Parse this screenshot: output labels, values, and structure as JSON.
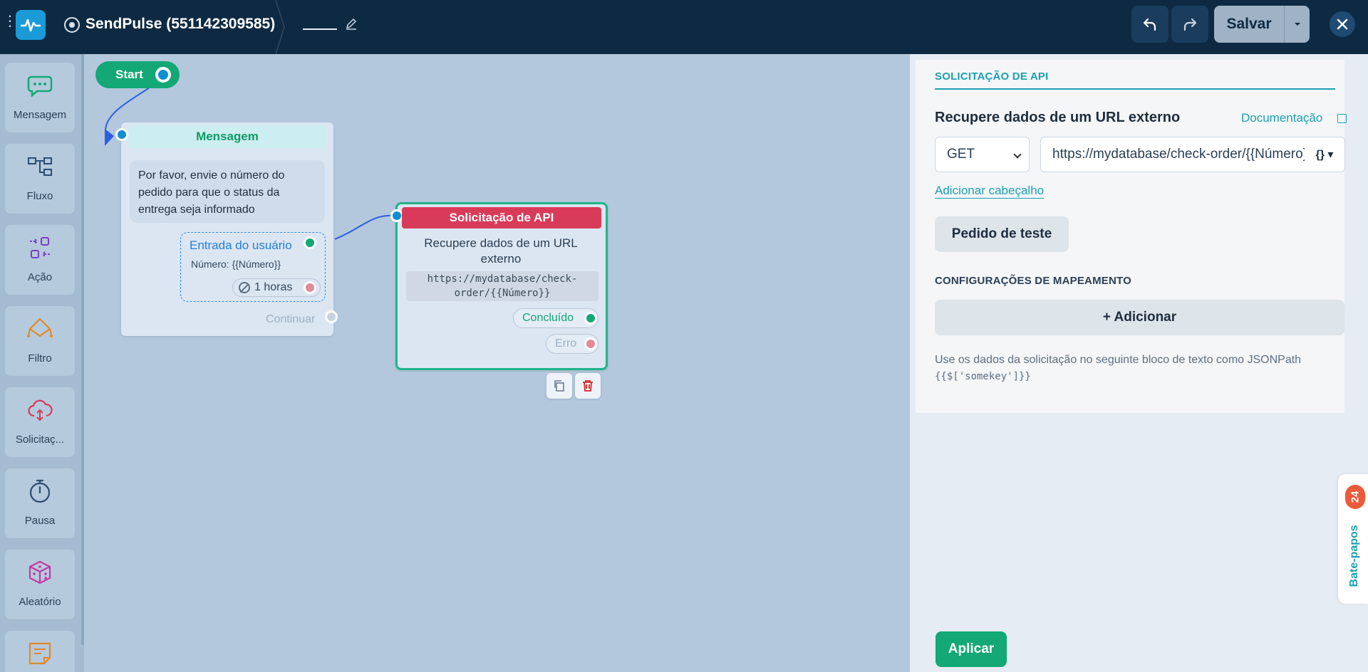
{
  "header": {
    "bot_name": "SendPulse (551142309585)",
    "save_label": "Salvar"
  },
  "sidebar": {
    "items": [
      {
        "label": "Mensagem",
        "icon": "chat-bubble-icon"
      },
      {
        "label": "Fluxo",
        "icon": "flow-icon"
      },
      {
        "label": "Ação",
        "icon": "action-icon"
      },
      {
        "label": "Filtro",
        "icon": "filter-icon"
      },
      {
        "label": "Solicitaç...",
        "icon": "cloud-request-icon"
      },
      {
        "label": "Pausa",
        "icon": "stopwatch-icon"
      },
      {
        "label": "Aleatório",
        "icon": "dice-icon"
      }
    ]
  },
  "canvas": {
    "start_label": "Start",
    "message_node": {
      "title": "Mensagem",
      "text": "Por favor, envie o número do pedido para que o status da entrega seja informado",
      "input_title": "Entrada do usuário",
      "input_var": "Número: {{Número}}",
      "timeout": "1 horas",
      "continue": "Continuar"
    },
    "api_node": {
      "title": "Solicitação de API",
      "description": "Recupere dados de um URL externo",
      "url": "https://mydatabase/check-order/{{Número}}",
      "done": "Concluído",
      "error": "Erro"
    }
  },
  "panel": {
    "section_title": "SOLICITAÇÃO DE API",
    "title": "Recupere dados de um URL externo",
    "doc_link": "Documentação",
    "method": "GET",
    "url_value": "https://mydatabase/check-order/{{Número}}",
    "var_button": "{} ▾",
    "add_header": "Adicionar cabeçalho",
    "test_button": "Pedido de teste",
    "mapping_title": "CONFIGURAÇÕES DE MAPEAMENTO",
    "add_button": "+ Adicionar",
    "help_text": "Use os dados da solicitação no seguinte bloco de texto como JSONPath",
    "help_code": "{{$['somekey']}}",
    "apply_button": "Aplicar"
  },
  "chats": {
    "label": "Bate-papos",
    "count": "24"
  },
  "colors": {
    "topbar": "#0e2a43",
    "accent_green": "#13a876",
    "accent_teal": "#1ca0b0",
    "api_red": "#d83b59",
    "canvas": "#b3c8dd"
  }
}
